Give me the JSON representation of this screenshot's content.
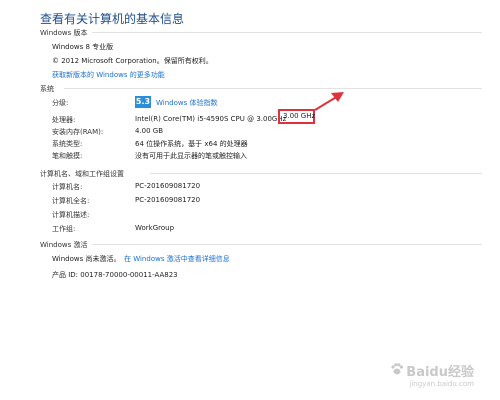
{
  "page_title": "查看有关计算机的基本信息",
  "windows_edition": {
    "header": "Windows 版本",
    "edition": "Windows 8 专业版",
    "copyright": "© 2012 Microsoft Corporation。保留所有权利。",
    "more_features_link": "获取新版本的 Windows 的更多功能"
  },
  "system": {
    "header": "系统",
    "rating_label": "分级:",
    "rating_score": "5.3",
    "rating_link": "Windows 体验指数",
    "processor_label": "处理器:",
    "processor_value": "Intel(R) Core(TM) i5-4590S CPU @ 3.00GHz",
    "processor_speed": "3.00 GHz",
    "ram_label": "安装内存(RAM):",
    "ram_value": "4.00 GB",
    "type_label": "系统类型:",
    "type_value": "64 位操作系统，基于 x64 的处理器",
    "pen_label": "笔和触摸:",
    "pen_value": "没有可用于此显示器的笔或触控输入"
  },
  "computer_name": {
    "header": "计算机名、域和工作组设置",
    "name_label": "计算机名:",
    "name_value": "PC-201609081720",
    "fullname_label": "计算机全名:",
    "fullname_value": "PC-201609081720",
    "description_label": "计算机描述:",
    "workgroup_label": "工作组:",
    "workgroup_value": "WorkGroup"
  },
  "activation": {
    "header": "Windows 激活",
    "status": "Windows 尚未激活。",
    "details_link": "在 Windows 激活中查看详细信息",
    "product_id": "产品 ID: 00178-70000-00011-AA823"
  },
  "watermark": {
    "brand": "Baidu经验",
    "url": "jingyan.baidu.com"
  },
  "colors": {
    "title": "#1f4e8c",
    "link": "#1a6fd0",
    "highlight": "#e0323c",
    "badge": "#2a8fd8"
  }
}
